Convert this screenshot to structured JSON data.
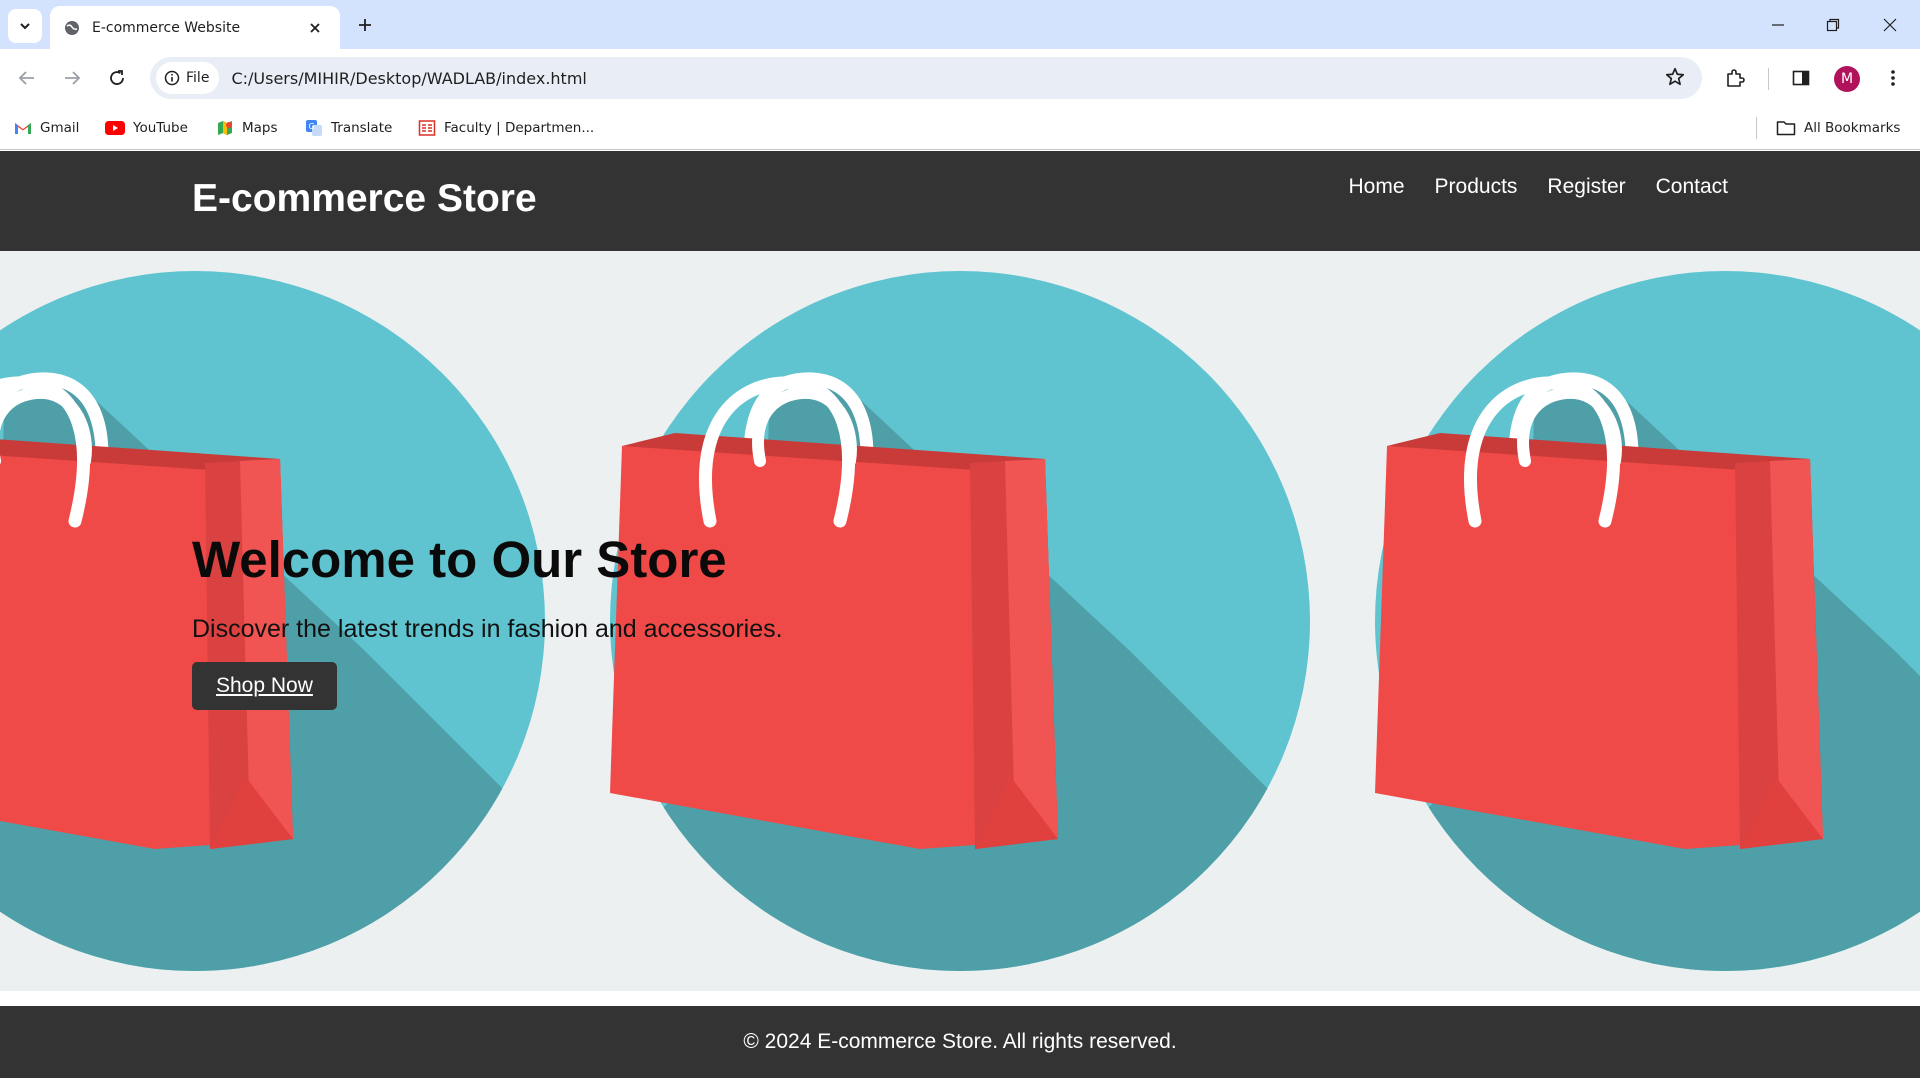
{
  "browser": {
    "tab_title": "E-commerce Website",
    "site_chip": "File",
    "url": "C:/Users/MIHIR/Desktop/WADLAB/index.html",
    "profile_initial": "M",
    "bookmarks": [
      {
        "label": "Gmail",
        "icon": "gmail-icon"
      },
      {
        "label": "YouTube",
        "icon": "youtube-icon"
      },
      {
        "label": "Maps",
        "icon": "maps-icon"
      },
      {
        "label": "Translate",
        "icon": "translate-icon"
      },
      {
        "label": "Faculty | Departmen...",
        "icon": "faculty-icon"
      }
    ],
    "all_bookmarks": "All Bookmarks"
  },
  "site": {
    "logo": "E-commerce Store",
    "nav": [
      "Home",
      "Products",
      "Register",
      "Contact"
    ],
    "hero": {
      "title": "Welcome to Our Store",
      "subtitle": "Discover the latest trends in fashion and accessories.",
      "button": "Shop Now"
    },
    "footer": "© 2024 E-commerce Store. All rights reserved."
  },
  "colors": {
    "header_bg": "#333333",
    "hero_bg": "#edf0f1",
    "circle": "#5fc4cf",
    "shadow": "#4e9fa7",
    "bag": "#ef4a47",
    "bag_dark": "#d94240",
    "tabstrip": "#d3e3fd"
  }
}
